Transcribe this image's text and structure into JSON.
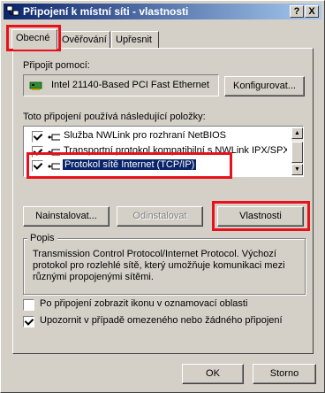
{
  "window": {
    "title": "Připojení k místní síti - vlastnosti",
    "help_btn": "?",
    "close_btn": "X"
  },
  "tabs": [
    {
      "label": "Obecné",
      "active": true
    },
    {
      "label": "Ověřování",
      "active": false
    },
    {
      "label": "Upřesnit",
      "active": false
    }
  ],
  "connect_using": {
    "label": "Připojit pomocí:",
    "adapter": "Intel 21140-Based PCI Fast Ethernet",
    "configure_btn": "Konfigurovat..."
  },
  "components": {
    "label": "Toto připojení používá následující položky:",
    "items": [
      {
        "label": "Služba NWLink pro rozhraní NetBIOS",
        "checked": true,
        "selected": false
      },
      {
        "label": "Transportní protokol kompatibilní s NWLink IPX/SPX/...",
        "checked": true,
        "selected": false
      },
      {
        "label": "Protokol sítě Internet (TCP/IP)",
        "checked": true,
        "selected": true
      }
    ]
  },
  "buttons": {
    "install": "Nainstalovat...",
    "uninstall": "Odinstalovat",
    "properties": "Vlastnosti"
  },
  "description": {
    "label": "Popis",
    "text": "Transmission Control Protocol/Internet Protocol. Výchozí protokol pro rozlehlé sítě, který umožňuje komunikaci mezi různými propojenými sítěmi."
  },
  "options": [
    {
      "label": "Po připojení zobrazit ikonu v oznamovací oblasti",
      "checked": false
    },
    {
      "label": "Upozornit v případě omezeného nebo žádného připojení",
      "checked": true
    }
  ],
  "footer": {
    "ok": "OK",
    "cancel": "Storno"
  },
  "colors": {
    "highlight": "#0a246a",
    "annotation": "#e8111b"
  }
}
